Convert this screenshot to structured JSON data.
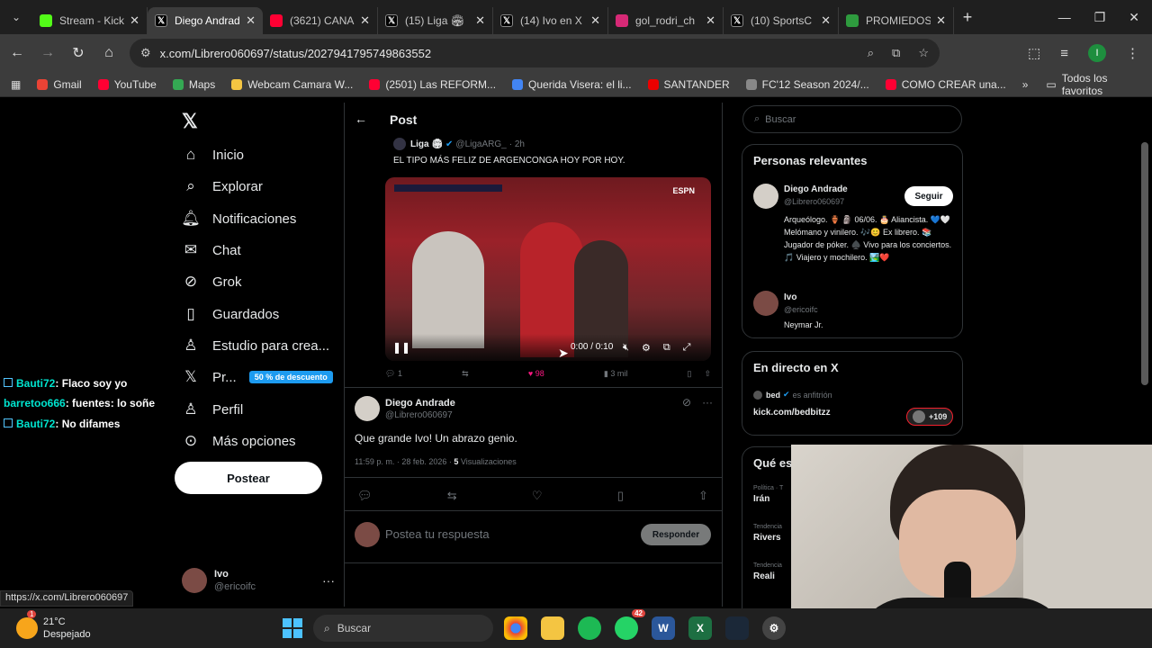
{
  "browser": {
    "tabs": [
      {
        "label": "Stream - Kick",
        "icon": "kick-icon",
        "color": "#53fc18"
      },
      {
        "label": "Diego Andrade",
        "icon": "x-logo-icon",
        "color": "#000000",
        "active": true
      },
      {
        "label": "(3621) CANAL",
        "icon": "youtube-icon",
        "color": "#ff0033"
      },
      {
        "label": "(15) Liga 🏟",
        "icon": "x-logo-icon",
        "color": "#000000"
      },
      {
        "label": "(14) Ivo en X",
        "icon": "x-logo-icon",
        "color": "#000000"
      },
      {
        "label": "gol_rodri_ch",
        "icon": "instagram-icon",
        "color": "#d62976"
      },
      {
        "label": "(10) SportsC",
        "icon": "x-logo-icon",
        "color": "#000000"
      },
      {
        "label": "PROMIEDOS",
        "icon": "promiedos-icon",
        "color": "#2e9b3e"
      }
    ],
    "url": "x.com/Librero060697/status/2027941795749863552",
    "bookmarks": [
      {
        "label": "Gmail",
        "color": "#ea4335"
      },
      {
        "label": "YouTube",
        "color": "#ff0033"
      },
      {
        "label": "Maps",
        "color": "#34a853"
      },
      {
        "label": "Webcam Camara W...",
        "color": "#f4c542"
      },
      {
        "label": "(2501) Las REFORM...",
        "color": "#ff0033"
      },
      {
        "label": "Querida Visera: el li...",
        "color": "#4285f4"
      },
      {
        "label": "SANTANDER",
        "color": "#ec0000"
      },
      {
        "label": "FC'12 Season 2024/...",
        "color": "#888888"
      },
      {
        "label": "COMO CREAR una...",
        "color": "#ff0033"
      }
    ],
    "all_bookmarks": "Todos los favoritos",
    "status_link": "https://x.com/Librero060697"
  },
  "nav": {
    "items": [
      "Inicio",
      "Explorar",
      "Notificaciones",
      "Chat",
      "Grok",
      "Guardados",
      "Estudio para crea...",
      "Pr..."
    ],
    "profile_label": "Perfil",
    "more_label": "Más opciones",
    "premium_badge": "50 % de descuento",
    "post_button": "Postear",
    "account_name": "Ivo",
    "account_handle": "@ericoifc"
  },
  "stream_chat": [
    {
      "user": "Bauti72",
      "text": ": Flaco soy yo",
      "badge": true
    },
    {
      "user": "barretoo666",
      "text": ": fuentes: lo soñe",
      "badge": false
    },
    {
      "user": "Bauti72",
      "text": ": No difames",
      "badge": true
    }
  ],
  "post_header": {
    "title": "Post"
  },
  "quoted": {
    "name": "Liga 🏟",
    "handle": "@LigaARG_",
    "time": "· 2h",
    "text": "EL TIPO MÁS FELIZ DE ARGENCONGA HOY POR HOY.",
    "video_time": "0:00 / 0:10",
    "video_brand": "ESPN",
    "stats": {
      "replies": "1",
      "likes": "98",
      "views": "3 mil"
    }
  },
  "main_post": {
    "name": "Diego Andrade",
    "handle": "@Librero060697",
    "text": "Que grande Ivo! Un abrazo genio.",
    "time": "11:59 p. m. · 28 feb. 2026 · ",
    "views_count": "5",
    "views_label": " Visualizaciones"
  },
  "reply": {
    "placeholder": "Postea tu respuesta",
    "button": "Responder"
  },
  "right": {
    "search_placeholder": "Buscar",
    "relevant_title": "Personas relevantes",
    "person1": {
      "name": "Diego Andrade",
      "handle": "@Librero060697",
      "follow": "Seguir",
      "bio": "Arqueólogo. 🏺 🗿 06/06. 🎂 Aliancista. 💙🤍 Melómano y vinilero. 🎶😊 Ex librero. 📚 Jugador de póker. ♠️ Vivo para los conciertos. 🎵 Viajero y mochilero. 🏞️❤️"
    },
    "person2": {
      "name": "Ivo",
      "handle": "@ericoifc",
      "bio": "Neymar Jr."
    },
    "live_title": "En directo en X",
    "live_user": "bed",
    "live_role": "es anfitrión",
    "live_link": "kick.com/bedbitzz",
    "live_count": "+109",
    "trends_title": "Qué es",
    "trends": [
      {
        "category": "Política · T",
        "name": "Irán"
      },
      {
        "category": "Tendencia",
        "name": "Rivers"
      },
      {
        "category": "Tendencia",
        "name": "Reali"
      }
    ]
  },
  "taskbar": {
    "temp": "21°C",
    "weather": "Despejado",
    "weather_badge": "1",
    "search": "Buscar",
    "whatsapp_badge": "42"
  }
}
